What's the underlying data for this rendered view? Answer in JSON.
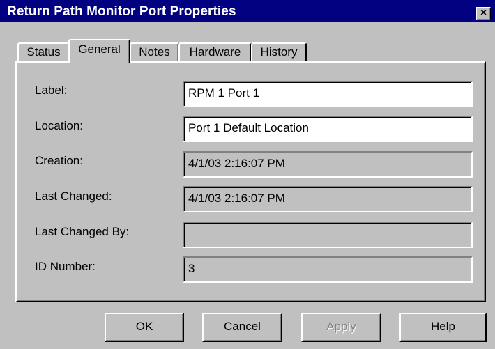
{
  "window": {
    "title": "Return Path Monitor Port Properties",
    "close_glyph": "×"
  },
  "tabs": [
    {
      "label": "Status"
    },
    {
      "label": "General",
      "active": true
    },
    {
      "label": "Notes"
    },
    {
      "label": "Hardware"
    },
    {
      "label": "History"
    }
  ],
  "general": {
    "label": {
      "label": "Label:",
      "value": "RPM 1 Port 1",
      "editable": true
    },
    "location": {
      "label": "Location:",
      "value": "Port 1 Default Location",
      "editable": true
    },
    "creation": {
      "label": "Creation:",
      "value": "4/1/03 2:16:07 PM",
      "editable": false
    },
    "last_changed": {
      "label": "Last Changed:",
      "value": "4/1/03 2:16:07 PM",
      "editable": false
    },
    "last_changed_by": {
      "label": "Last Changed By:",
      "value": "",
      "editable": false
    },
    "id_number": {
      "label": "ID Number:",
      "value": "3",
      "editable": false
    }
  },
  "buttons": {
    "ok": "OK",
    "cancel": "Cancel",
    "apply": "Apply",
    "help": "Help"
  },
  "colors": {
    "titlebar": "#000080",
    "face": "#c0c0c0",
    "disabled_text": "#808080"
  }
}
